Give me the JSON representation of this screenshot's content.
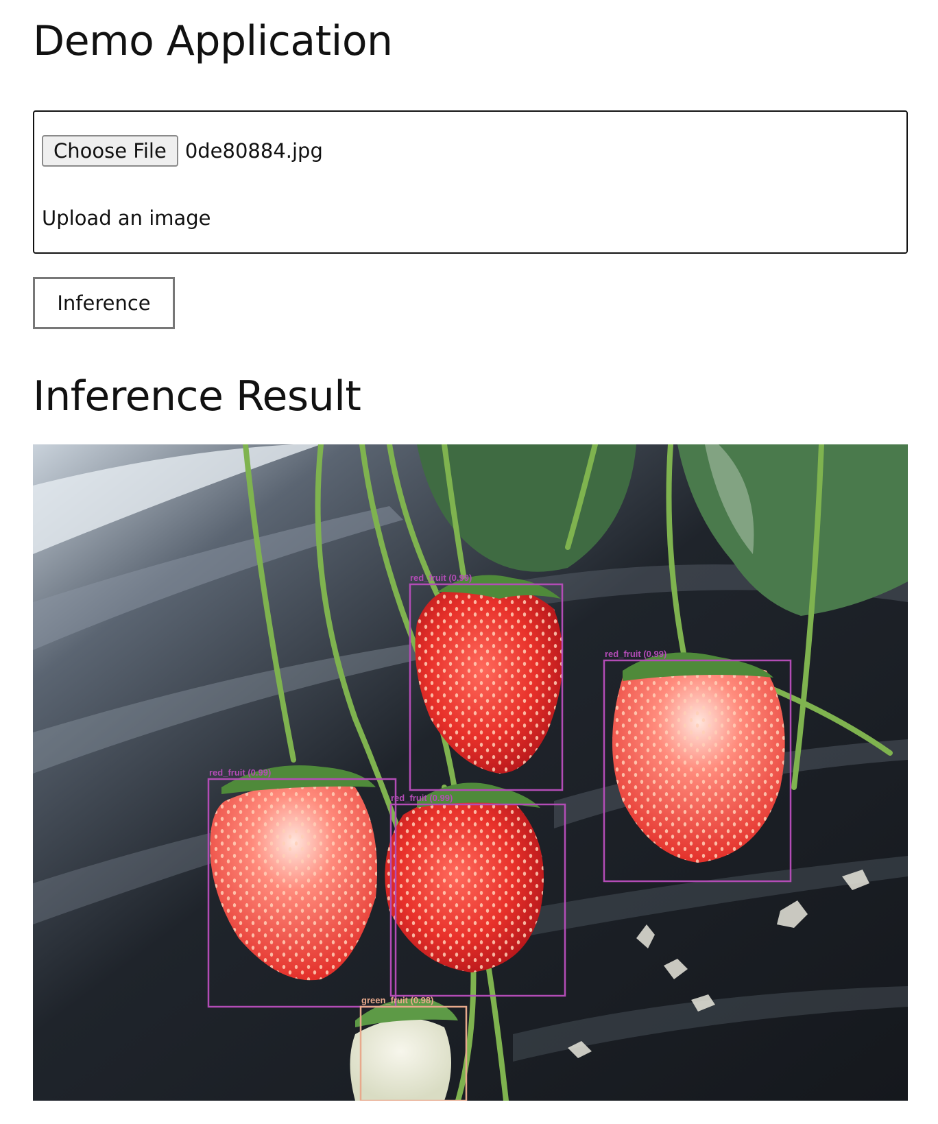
{
  "header": {
    "title": "Demo Application"
  },
  "upload": {
    "choose_file_label": "Choose File",
    "file_name": "0de80884.jpg",
    "label": "Upload an image"
  },
  "actions": {
    "inference_label": "Inference"
  },
  "result": {
    "title": "Inference Result",
    "detections": [
      {
        "label": "red_fruit (0.99)",
        "color": "#b34cb6"
      },
      {
        "label": "red_fruit (0.99)",
        "color": "#b34cb6"
      },
      {
        "label": "red_fruit (0.99)",
        "color": "#b34cb6"
      },
      {
        "label": "red_fruit (0.99)",
        "color": "#b34cb6"
      },
      {
        "label": "green_fruit (0.98)",
        "color": "#e8a98c"
      }
    ]
  }
}
